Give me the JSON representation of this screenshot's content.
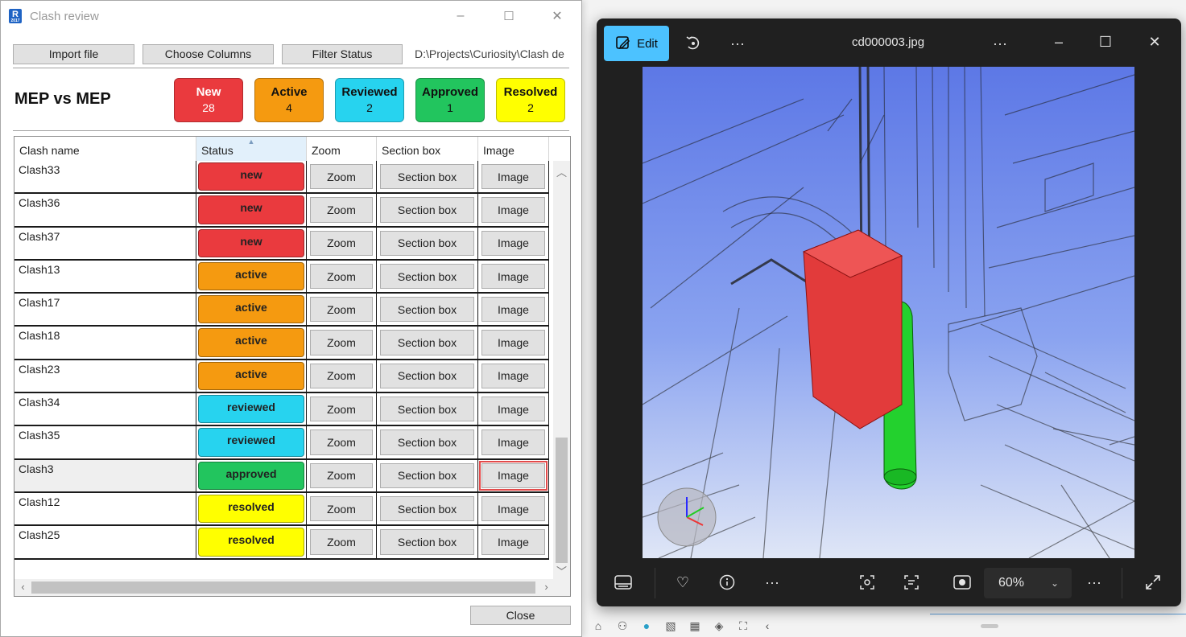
{
  "clash_review": {
    "window_title": "Clash review",
    "app_icon": "R",
    "app_icon_sub": "2017",
    "controls": {
      "minimize": "–",
      "maximize": "☐",
      "close": "✕"
    },
    "toolbar": {
      "import_label": "Import file",
      "columns_label": "Choose Columns",
      "filter_label": "Filter Status",
      "path": "D:\\Projects\\Curiosity\\Clash de"
    },
    "report_title": "MEP vs MEP",
    "status_cards": [
      {
        "label": "New",
        "count": "28",
        "color": "#ea3a3e",
        "text_color": "#ffffff"
      },
      {
        "label": "Active",
        "count": "4",
        "color": "#f59a10",
        "text_color": "#111111"
      },
      {
        "label": "Reviewed",
        "count": "2",
        "color": "#27d3ef",
        "text_color": "#111111"
      },
      {
        "label": "Approved",
        "count": "1",
        "color": "#22c55e",
        "text_color": "#111111"
      },
      {
        "label": "Resolved",
        "count": "2",
        "color": "#ffff00",
        "text_color": "#111111"
      }
    ],
    "columns": [
      "Clash name",
      "Status",
      "Zoom",
      "Section box",
      "Image"
    ],
    "button_labels": {
      "zoom": "Zoom",
      "section": "Section box",
      "image": "Image"
    },
    "status_colors": {
      "new": "#ea3a3e",
      "active": "#f59a10",
      "reviewed": "#27d3ef",
      "approved": "#22c55e",
      "resolved": "#ffff00"
    },
    "rows": [
      {
        "name": "Clash33",
        "status": "new"
      },
      {
        "name": "Clash36",
        "status": "new"
      },
      {
        "name": "Clash37",
        "status": "new"
      },
      {
        "name": "Clash13",
        "status": "active"
      },
      {
        "name": "Clash17",
        "status": "active"
      },
      {
        "name": "Clash18",
        "status": "active"
      },
      {
        "name": "Clash23",
        "status": "active"
      },
      {
        "name": "Clash34",
        "status": "reviewed"
      },
      {
        "name": "Clash35",
        "status": "reviewed"
      },
      {
        "name": "Clash3",
        "status": "approved",
        "selected": true
      },
      {
        "name": "Clash12",
        "status": "resolved"
      },
      {
        "name": "Clash25",
        "status": "resolved"
      }
    ],
    "close_label": "Close"
  },
  "photo_viewer": {
    "edit_label": "Edit",
    "filename": "cd000003.jpg",
    "zoom_level": "60%",
    "icons": {
      "top": [
        "edit-icon",
        "rotate-icon",
        "more-icon",
        "more-icon",
        "minimize-icon",
        "maximize-icon",
        "close-icon"
      ],
      "bottom": [
        "filmstrip-icon",
        "favorite-icon",
        "info-icon",
        "more-icon",
        "visual-search-icon",
        "text-scan-icon",
        "background-blur-icon",
        "chevron-down-icon",
        "more-icon",
        "fullscreen-icon"
      ]
    },
    "glyphs": {
      "more": "···",
      "minimize": "–",
      "maximize": "☐",
      "close": "✕",
      "chevron": "⌄"
    }
  }
}
